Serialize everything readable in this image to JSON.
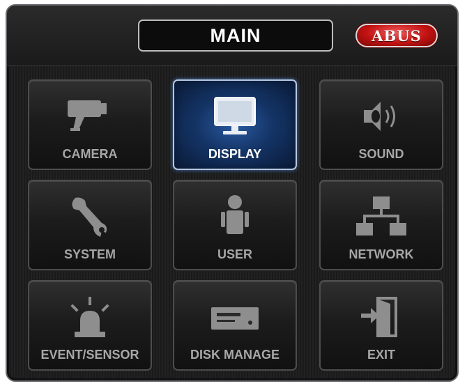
{
  "header": {
    "title": "MAIN",
    "logo_text": "ABUS"
  },
  "colors": {
    "panel_bg": "#1e1e1e",
    "tile_label": "#a7a7a7",
    "selected_glow": "#2a5aa0",
    "logo_red": "#c21212"
  },
  "menu": {
    "selected": "DISPLAY",
    "items": [
      {
        "label": "CAMERA",
        "icon": "camera-icon"
      },
      {
        "label": "DISPLAY",
        "icon": "monitor-icon"
      },
      {
        "label": "SOUND",
        "icon": "speaker-icon"
      },
      {
        "label": "SYSTEM",
        "icon": "wrench-icon"
      },
      {
        "label": "USER",
        "icon": "user-icon"
      },
      {
        "label": "NETWORK",
        "icon": "network-icon"
      },
      {
        "label": "EVENT/SENSOR",
        "icon": "alarm-light-icon"
      },
      {
        "label": "DISK MANAGE",
        "icon": "disk-drive-icon"
      },
      {
        "label": "EXIT",
        "icon": "exit-door-icon"
      }
    ]
  }
}
